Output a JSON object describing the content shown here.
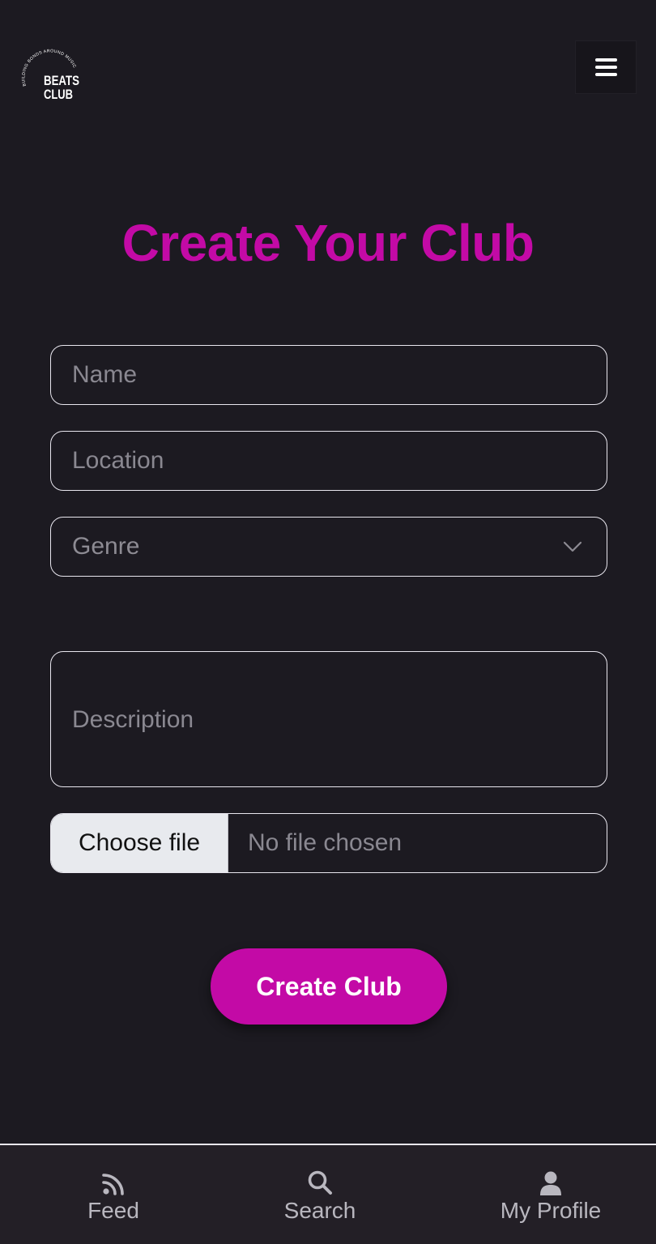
{
  "brand": {
    "logo_text": "BEATS CLUB",
    "logo_tagline": "BUILDING BONDS AROUND MUSIC"
  },
  "header": {
    "menu_icon": "hamburger-icon"
  },
  "page": {
    "title": "Create Your Club"
  },
  "form": {
    "name_placeholder": "Name",
    "location_placeholder": "Location",
    "genre_placeholder": "Genre",
    "genre_icon": "chevron-down-icon",
    "description_placeholder": "Description",
    "file_button_label": "Choose file",
    "file_status": "No file chosen",
    "submit_label": "Create Club"
  },
  "nav": {
    "items": [
      {
        "label": "Feed",
        "icon": "rss-icon"
      },
      {
        "label": "Search",
        "icon": "search-icon"
      },
      {
        "label": "My Profile",
        "icon": "user-icon"
      }
    ]
  },
  "colors": {
    "background": "#1c1a21",
    "accent": "#c30aa6",
    "field_border": "#e8e6ee",
    "placeholder": "#8a8891",
    "nav_background": "#231f26"
  }
}
